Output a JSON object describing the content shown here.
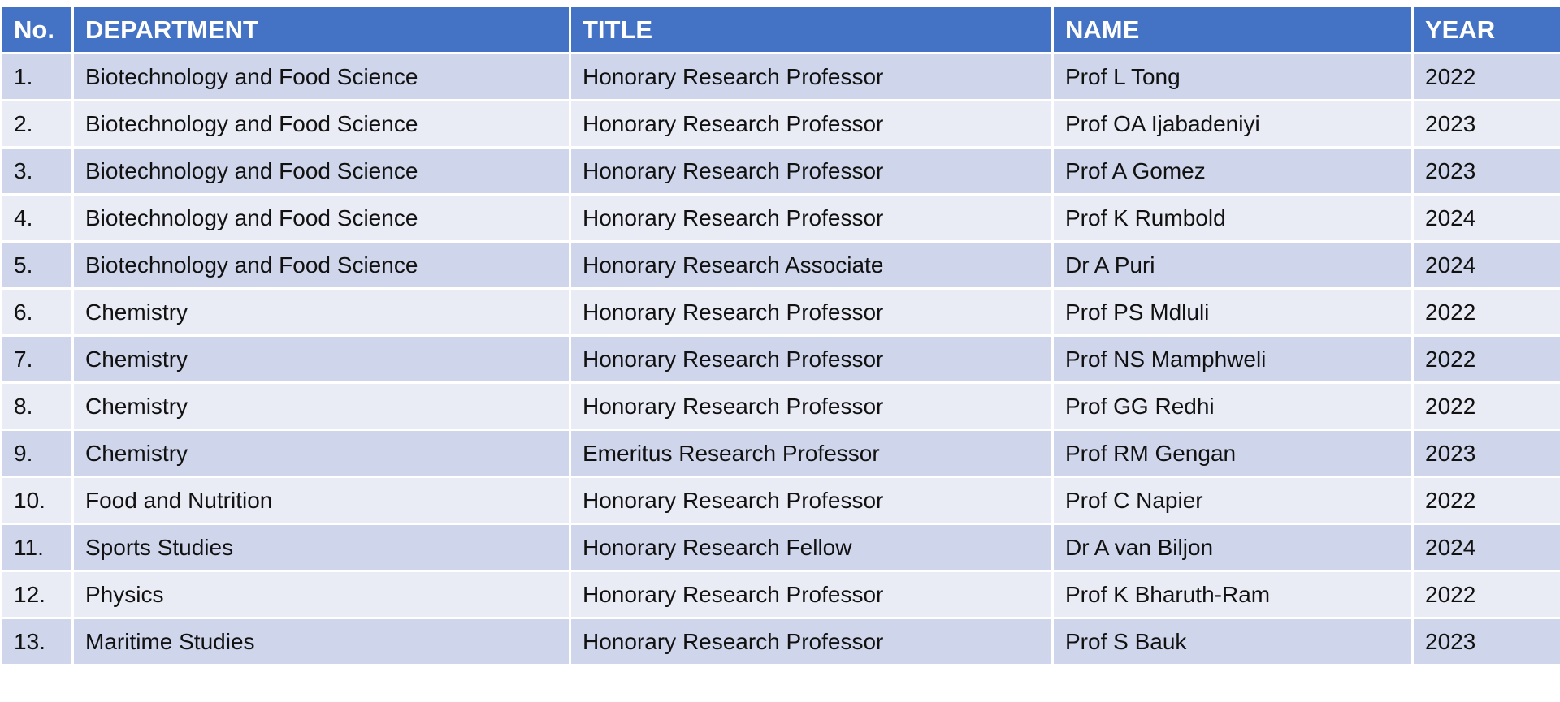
{
  "table": {
    "headers": [
      "No.",
      "DEPARTMENT",
      "TITLE",
      "NAME",
      "YEAR"
    ],
    "rows": [
      [
        "1.",
        "Biotechnology and Food Science",
        "Honorary Research Professor",
        "Prof L Tong",
        "2022"
      ],
      [
        "2.",
        "Biotechnology and Food Science",
        "Honorary Research Professor",
        "Prof OA Ijabadeniyi",
        "2023"
      ],
      [
        "3.",
        "Biotechnology and Food Science",
        "Honorary Research Professor",
        "Prof A Gomez",
        "2023"
      ],
      [
        "4.",
        "Biotechnology and Food Science",
        "Honorary Research Professor",
        "Prof K Rumbold",
        "2024"
      ],
      [
        "5.",
        "Biotechnology and Food Science",
        "Honorary Research Associate",
        "Dr A Puri",
        "2024"
      ],
      [
        "6.",
        "Chemistry",
        "Honorary Research Professor",
        "Prof PS Mdluli",
        "2022"
      ],
      [
        "7.",
        "Chemistry",
        "Honorary Research Professor",
        "Prof NS Mamphweli",
        "2022"
      ],
      [
        "8.",
        "Chemistry",
        "Honorary Research Professor",
        "Prof GG Redhi",
        "2022"
      ],
      [
        "9.",
        "Chemistry",
        "Emeritus Research Professor",
        "Prof RM Gengan",
        "2023"
      ],
      [
        "10.",
        "Food and Nutrition",
        "Honorary Research Professor",
        "Prof C Napier",
        "2022"
      ],
      [
        "11.",
        "Sports Studies",
        "Honorary Research Fellow",
        "Dr A van Biljon",
        "2024"
      ],
      [
        "12.",
        "Physics",
        "Honorary Research Professor",
        "Prof K Bharuth-Ram",
        "2022"
      ],
      [
        "13.",
        "Maritime Studies",
        "Honorary Research Professor",
        "Prof S Bauk",
        "2023"
      ]
    ]
  },
  "colors": {
    "header_bg": "#4472c4",
    "row_odd_bg": "#cfd5ea",
    "row_even_bg": "#e9ebf5"
  }
}
